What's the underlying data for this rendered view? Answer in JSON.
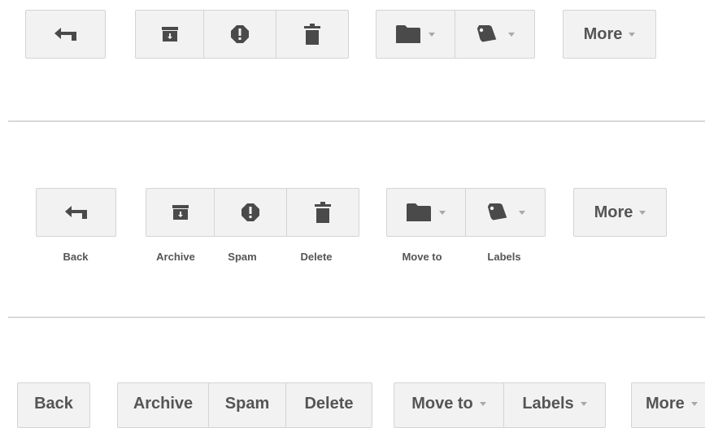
{
  "colors": {
    "button_bg": "#f2f2f2",
    "button_border": "#d4d4d4",
    "icon": "#4a4a4a",
    "divider": "#d8d8d8"
  },
  "row1": {
    "more_label": "More"
  },
  "row2": {
    "more_label": "More",
    "captions": {
      "back": "Back",
      "archive": "Archive",
      "spam": "Spam",
      "delete": "Delete",
      "move_to": "Move to",
      "labels": "Labels"
    }
  },
  "row3": {
    "back": "Back",
    "archive": "Archive",
    "spam": "Spam",
    "delete": "Delete",
    "move_to": "Move to",
    "labels": "Labels",
    "more": "More"
  },
  "icons": [
    "back-arrow-icon",
    "archive-icon",
    "spam-icon",
    "trash-icon",
    "folder-icon",
    "tag-icon",
    "chevron-down-icon"
  ]
}
